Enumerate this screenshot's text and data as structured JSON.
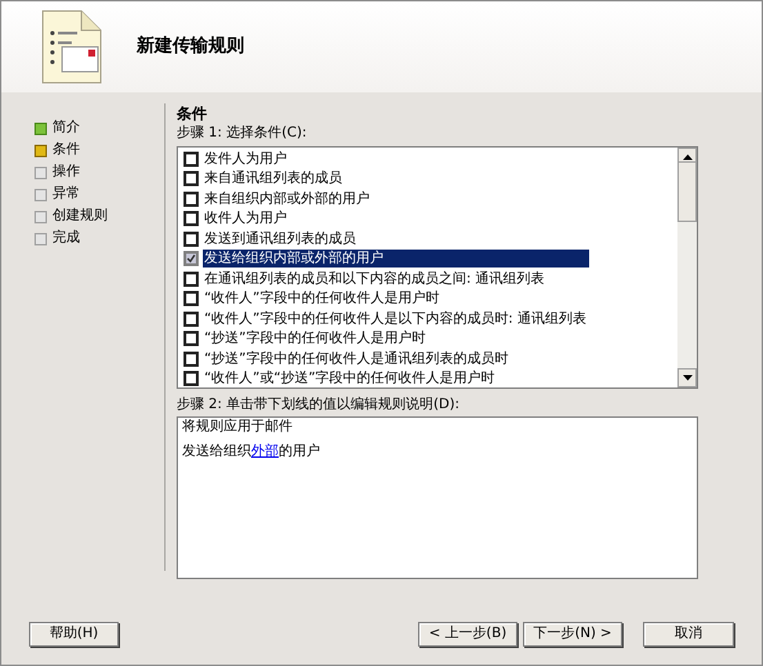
{
  "window": {
    "title": "新建传输规则"
  },
  "nav": [
    {
      "label": "简介",
      "kind": "done"
    },
    {
      "label": "条件",
      "kind": "current"
    },
    {
      "label": "操作",
      "kind": "pending"
    },
    {
      "label": "异常",
      "kind": "pending"
    },
    {
      "label": "创建规则",
      "kind": "pending"
    },
    {
      "label": "完成",
      "kind": "pending"
    }
  ],
  "section_title": "条件",
  "step1_label": "步骤 1:  选择条件(C):",
  "conditions": [
    {
      "label": "发件人为用户",
      "checked": false,
      "selected": false
    },
    {
      "label": "来自通讯组列表的成员",
      "checked": false,
      "selected": false
    },
    {
      "label": "来自组织内部或外部的用户",
      "checked": false,
      "selected": false
    },
    {
      "label": "收件人为用户",
      "checked": false,
      "selected": false
    },
    {
      "label": "发送到通讯组列表的成员",
      "checked": false,
      "selected": false
    },
    {
      "label": "发送给组织内部或外部的用户",
      "checked": true,
      "selected": true
    },
    {
      "label": "在通讯组列表的成员和以下内容的成员之间: 通讯组列表",
      "checked": false,
      "selected": false
    },
    {
      "label": "“收件人”字段中的任何收件人是用户时",
      "checked": false,
      "selected": false
    },
    {
      "label": "“收件人”字段中的任何收件人是以下内容的成员时: 通讯组列表",
      "checked": false,
      "selected": false
    },
    {
      "label": "“抄送”字段中的任何收件人是用户时",
      "checked": false,
      "selected": false
    },
    {
      "label": "“抄送”字段中的任何收件人是通讯组列表的成员时",
      "checked": false,
      "selected": false
    },
    {
      "label": "“收件人”或“抄送”字段中的任何收件人是用户时",
      "checked": false,
      "selected": false
    }
  ],
  "step2_label": "步骤 2:  单击带下划线的值以编辑规则说明(D):",
  "description": {
    "heading": "将规则应用于邮件",
    "before": "发送给组织",
    "link": "外部",
    "after": "的用户"
  },
  "buttons": {
    "help": "帮助(H)",
    "back": "< 上一步(B)",
    "next": "下一步(N) >",
    "cancel": "取消"
  }
}
